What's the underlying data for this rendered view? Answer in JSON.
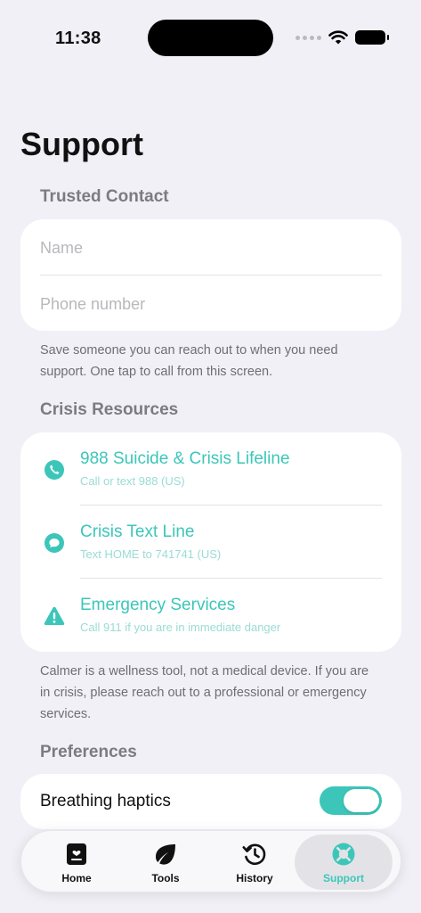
{
  "status_bar": {
    "time": "11:38"
  },
  "page_title": "Support",
  "trusted_contact": {
    "header": "Trusted Contact",
    "name_placeholder": "Name",
    "phone_placeholder": "Phone number",
    "footnote": "Save someone you can reach out to when you need support. One tap to call from this screen."
  },
  "crisis": {
    "header": "Crisis Resources",
    "items": [
      {
        "title": "988 Suicide & Crisis Lifeline",
        "subtitle": "Call or text 988 (US)",
        "icon": "phone-icon"
      },
      {
        "title": "Crisis Text Line",
        "subtitle": "Text HOME to 741741 (US)",
        "icon": "message-bubble-icon"
      },
      {
        "title": "Emergency Services",
        "subtitle": "Call 911 if you are in immediate danger",
        "icon": "warning-triangle-icon"
      }
    ],
    "footnote": "Calmer is a wellness tool, not a medical device. If you are in crisis, please reach out to a professional or emergency services."
  },
  "preferences": {
    "header": "Preferences",
    "breathing_haptics_label": "Breathing haptics",
    "breathing_haptics_on": true
  },
  "tab_bar": {
    "tabs": [
      {
        "label": "Home",
        "icon": "journal-icon",
        "active": false
      },
      {
        "label": "Tools",
        "icon": "leaf-icon",
        "active": false
      },
      {
        "label": "History",
        "icon": "history-clock-icon",
        "active": false
      },
      {
        "label": "Support",
        "icon": "lifebuoy-icon",
        "active": true
      }
    ]
  },
  "colors": {
    "accent": "#3cc6b9",
    "background": "#f1f0f6",
    "card": "#ffffff"
  }
}
